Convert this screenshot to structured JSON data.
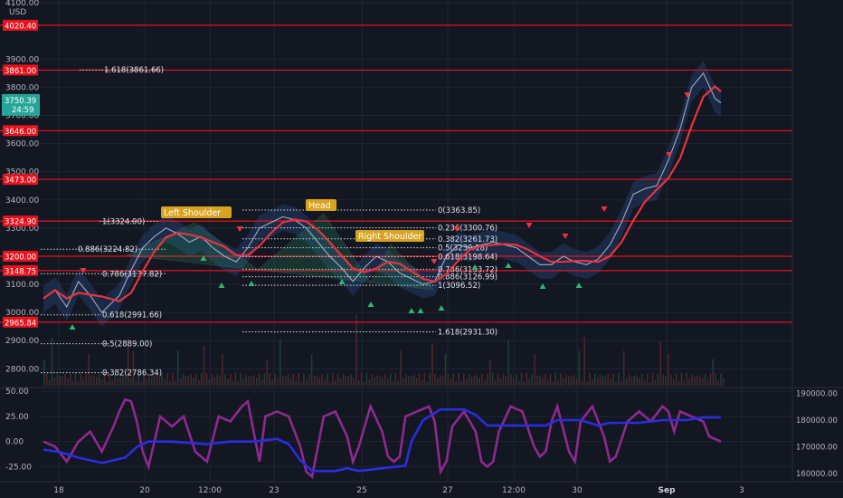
{
  "chart_data": [
    {
      "type": "line",
      "price_axis": {
        "currency": "USD",
        "ticks": [
          "4100.00",
          "3900.00",
          "3800.00",
          "3700.00",
          "3600.00",
          "3500.00",
          "3400.00",
          "3300.00",
          "3100.00",
          "3000.00",
          "2900.00",
          "2800.00"
        ],
        "tick_values": [
          4100,
          3900,
          3800,
          3700,
          3600,
          3500,
          3400,
          3300,
          3100,
          3000,
          2900,
          2800
        ],
        "range": [
          2740,
          4110
        ],
        "current_price": "3750.39",
        "countdown": "24:59"
      },
      "horizontal_levels": [
        {
          "label": "4020.40",
          "value": 4020.4
        },
        {
          "label": "3861.00",
          "value": 3861.0
        },
        {
          "label": "3646.00",
          "value": 3646.0
        },
        {
          "label": "3473.00",
          "value": 3473.0
        },
        {
          "label": "3324.90",
          "value": 3324.9
        },
        {
          "label": "3200.00",
          "value": 3200.0
        },
        {
          "label": "3148.75",
          "value": 3148.75
        },
        {
          "label": "2965.84",
          "value": 2965.84
        }
      ],
      "time_axis": {
        "labels": [
          "18",
          "20",
          "12:00",
          "23",
          "25",
          "27",
          "12:00",
          "30",
          "Sep",
          "3"
        ]
      },
      "fib_left": [
        {
          "label": "1.618(3861.66)",
          "value": 3861.66
        },
        {
          "label": "1(3324.00)",
          "value": 3324.0
        },
        {
          "label": "0.886(3224.82)",
          "value": 3224.82
        },
        {
          "label": "0.786(3137.82)",
          "value": 3137.82
        },
        {
          "label": "0.618(2991.66)",
          "value": 2991.66
        },
        {
          "label": "0.5(2889.00)",
          "value": 2889.0
        },
        {
          "label": "0.382(2786.34)",
          "value": 2786.34
        }
      ],
      "fib_right": [
        {
          "label": "0(3363.85)",
          "value": 3363.85
        },
        {
          "label": "0.236(3300.76)",
          "value": 3300.76
        },
        {
          "label": "0.382(3261.73)",
          "value": 3261.73
        },
        {
          "label": "0.5(3230.18)",
          "value": 3230.18
        },
        {
          "label": "0.618(3198.64)",
          "value": 3198.64
        },
        {
          "label": "0.786(3153.72)",
          "value": 3153.72
        },
        {
          "label": "0.886(3126.99)",
          "value": 3126.99
        },
        {
          "label": "1(3096.52)",
          "value": 3096.52
        },
        {
          "label": "1.618(2931.30)",
          "value": 2931.3
        }
      ],
      "pattern_labels": [
        "Left Shoulder",
        "Head",
        "Right Shoulder"
      ],
      "price_series": [
        [
          0,
          3050
        ],
        [
          4,
          3080
        ],
        [
          8,
          3020
        ],
        [
          12,
          3110
        ],
        [
          16,
          3060
        ],
        [
          20,
          3000
        ],
        [
          26,
          3060
        ],
        [
          30,
          3150
        ],
        [
          34,
          3230
        ],
        [
          38,
          3270
        ],
        [
          42,
          3300
        ],
        [
          46,
          3280
        ],
        [
          50,
          3250
        ],
        [
          54,
          3270
        ],
        [
          58,
          3230
        ],
        [
          62,
          3200
        ],
        [
          66,
          3180
        ],
        [
          70,
          3230
        ],
        [
          74,
          3300
        ],
        [
          78,
          3320
        ],
        [
          82,
          3340
        ],
        [
          86,
          3330
        ],
        [
          90,
          3300
        ],
        [
          94,
          3250
        ],
        [
          98,
          3200
        ],
        [
          102,
          3160
        ],
        [
          106,
          3110
        ],
        [
          110,
          3160
        ],
        [
          114,
          3200
        ],
        [
          118,
          3180
        ],
        [
          122,
          3140
        ],
        [
          126,
          3120
        ],
        [
          130,
          3100
        ],
        [
          134,
          3110
        ],
        [
          138,
          3200
        ],
        [
          142,
          3240
        ],
        [
          146,
          3230
        ],
        [
          150,
          3240
        ],
        [
          154,
          3250
        ],
        [
          158,
          3240
        ],
        [
          162,
          3230
        ],
        [
          166,
          3200
        ],
        [
          170,
          3170
        ],
        [
          174,
          3170
        ],
        [
          178,
          3200
        ],
        [
          182,
          3180
        ],
        [
          186,
          3170
        ],
        [
          190,
          3190
        ],
        [
          194,
          3240
        ],
        [
          198,
          3320
        ],
        [
          202,
          3420
        ],
        [
          206,
          3440
        ],
        [
          210,
          3450
        ],
        [
          214,
          3540
        ],
        [
          218,
          3650
        ],
        [
          222,
          3800
        ],
        [
          226,
          3850
        ],
        [
          230,
          3760
        ],
        [
          232,
          3745
        ]
      ],
      "indicator": {
        "ticks": [
          "50.00",
          "25.00",
          "0.00",
          "-25.00"
        ],
        "tick_values": [
          50,
          25,
          0,
          -25
        ],
        "range": [
          -40,
          52
        ],
        "right_ticks": [
          "190000.00",
          "180000.00",
          "170000.00",
          "160000.00"
        ],
        "right_tick_values": [
          190000,
          180000,
          170000,
          160000
        ],
        "right_range": [
          157000,
          191500
        ],
        "oscillator": [
          [
            0,
            0
          ],
          [
            4,
            -5
          ],
          [
            8,
            -20
          ],
          [
            12,
            0
          ],
          [
            16,
            10
          ],
          [
            20,
            -10
          ],
          [
            24,
            15
          ],
          [
            26,
            30
          ],
          [
            28,
            42
          ],
          [
            30,
            40
          ],
          [
            32,
            20
          ],
          [
            34,
            -10
          ],
          [
            36,
            -25
          ],
          [
            38,
            0
          ],
          [
            40,
            25
          ],
          [
            44,
            15
          ],
          [
            48,
            25
          ],
          [
            52,
            -10
          ],
          [
            56,
            -20
          ],
          [
            60,
            25
          ],
          [
            64,
            20
          ],
          [
            68,
            35
          ],
          [
            70,
            40
          ],
          [
            72,
            10
          ],
          [
            74,
            -20
          ],
          [
            76,
            25
          ],
          [
            80,
            30
          ],
          [
            84,
            25
          ],
          [
            88,
            -5
          ],
          [
            90,
            -30
          ],
          [
            92,
            -35
          ],
          [
            94,
            -5
          ],
          [
            96,
            25
          ],
          [
            100,
            30
          ],
          [
            104,
            5
          ],
          [
            106,
            -20
          ],
          [
            108,
            -5
          ],
          [
            112,
            35
          ],
          [
            116,
            10
          ],
          [
            118,
            -15
          ],
          [
            120,
            -20
          ],
          [
            122,
            -15
          ],
          [
            124,
            25
          ],
          [
            128,
            30
          ],
          [
            132,
            35
          ],
          [
            134,
            20
          ],
          [
            136,
            -30
          ],
          [
            138,
            -20
          ],
          [
            140,
            15
          ],
          [
            144,
            30
          ],
          [
            148,
            10
          ],
          [
            150,
            -20
          ],
          [
            152,
            -25
          ],
          [
            154,
            -20
          ],
          [
            156,
            10
          ],
          [
            160,
            35
          ],
          [
            164,
            30
          ],
          [
            168,
            -5
          ],
          [
            170,
            -15
          ],
          [
            172,
            -10
          ],
          [
            174,
            20
          ],
          [
            176,
            35
          ],
          [
            180,
            -10
          ],
          [
            182,
            -20
          ],
          [
            184,
            20
          ],
          [
            188,
            35
          ],
          [
            192,
            5
          ],
          [
            194,
            -20
          ],
          [
            196,
            -15
          ],
          [
            200,
            20
          ],
          [
            204,
            30
          ],
          [
            208,
            20
          ],
          [
            212,
            35
          ],
          [
            214,
            30
          ],
          [
            216,
            10
          ],
          [
            218,
            30
          ],
          [
            222,
            25
          ],
          [
            226,
            20
          ],
          [
            228,
            5
          ],
          [
            232,
            0
          ]
        ],
        "volume_line": [
          [
            0,
            169000
          ],
          [
            6,
            168000
          ],
          [
            12,
            166000
          ],
          [
            20,
            164000
          ],
          [
            28,
            166000
          ],
          [
            32,
            170000
          ],
          [
            36,
            172000
          ],
          [
            44,
            172000
          ],
          [
            56,
            171000
          ],
          [
            64,
            172000
          ],
          [
            72,
            172000
          ],
          [
            80,
            173000
          ],
          [
            84,
            171000
          ],
          [
            88,
            165000
          ],
          [
            92,
            161000
          ],
          [
            100,
            161000
          ],
          [
            104,
            162000
          ],
          [
            108,
            161000
          ],
          [
            116,
            162000
          ],
          [
            124,
            163000
          ],
          [
            126,
            172000
          ],
          [
            130,
            180000
          ],
          [
            136,
            184000
          ],
          [
            144,
            184000
          ],
          [
            148,
            182000
          ],
          [
            152,
            178000
          ],
          [
            164,
            178000
          ],
          [
            172,
            178000
          ],
          [
            176,
            180000
          ],
          [
            184,
            180000
          ],
          [
            190,
            178000
          ],
          [
            194,
            179000
          ],
          [
            204,
            179000
          ],
          [
            212,
            180000
          ],
          [
            220,
            180000
          ],
          [
            226,
            181000
          ],
          [
            232,
            181000
          ]
        ]
      }
    }
  ]
}
